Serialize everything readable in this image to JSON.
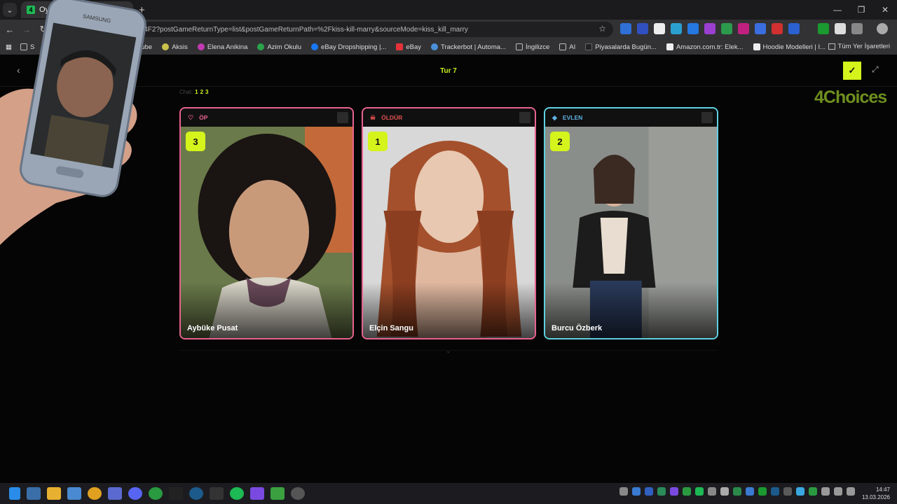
{
  "browser": {
    "tab_title": "Oyun |",
    "url": "D4F2?postGameReturnType=list&postGameReturnPath=%2Fkiss-kill-marry&sourceMode=kiss_kill_marry",
    "bookmarks": [
      "S",
      "ube",
      "Aksis",
      "Elena Anikina",
      "Azim Okulu",
      "eBay Dropshipping |...",
      "eBay",
      "Trackerbot | Automa...",
      "İngilizce",
      "AI",
      "Piyasalarda Bugün...",
      "Amazon.com.tr: Elek...",
      "Hoodie Modelleri | I..."
    ],
    "all_bookmarks": "Tüm Yer İşaretleri"
  },
  "game": {
    "round_title": "Tur 7",
    "pager_label": "Chat:",
    "pages": [
      "1",
      "2",
      "3"
    ],
    "logo": "4Choices",
    "cards": [
      {
        "category": "ÖP",
        "rank": "3",
        "name": "Aybüke Pusat",
        "color": "#e8628f"
      },
      {
        "category": "ÖLDÜR",
        "rank": "1",
        "name": "Elçin Sangu",
        "color": "#e8628f"
      },
      {
        "category": "EVLEN",
        "rank": "2",
        "name": "Burcu Özberk",
        "color": "#5fd0e0"
      }
    ]
  },
  "overlay": {
    "phone_brand": "SAMSUNG"
  },
  "taskbar": {
    "time": "14:47",
    "date": "13.03.2026"
  }
}
